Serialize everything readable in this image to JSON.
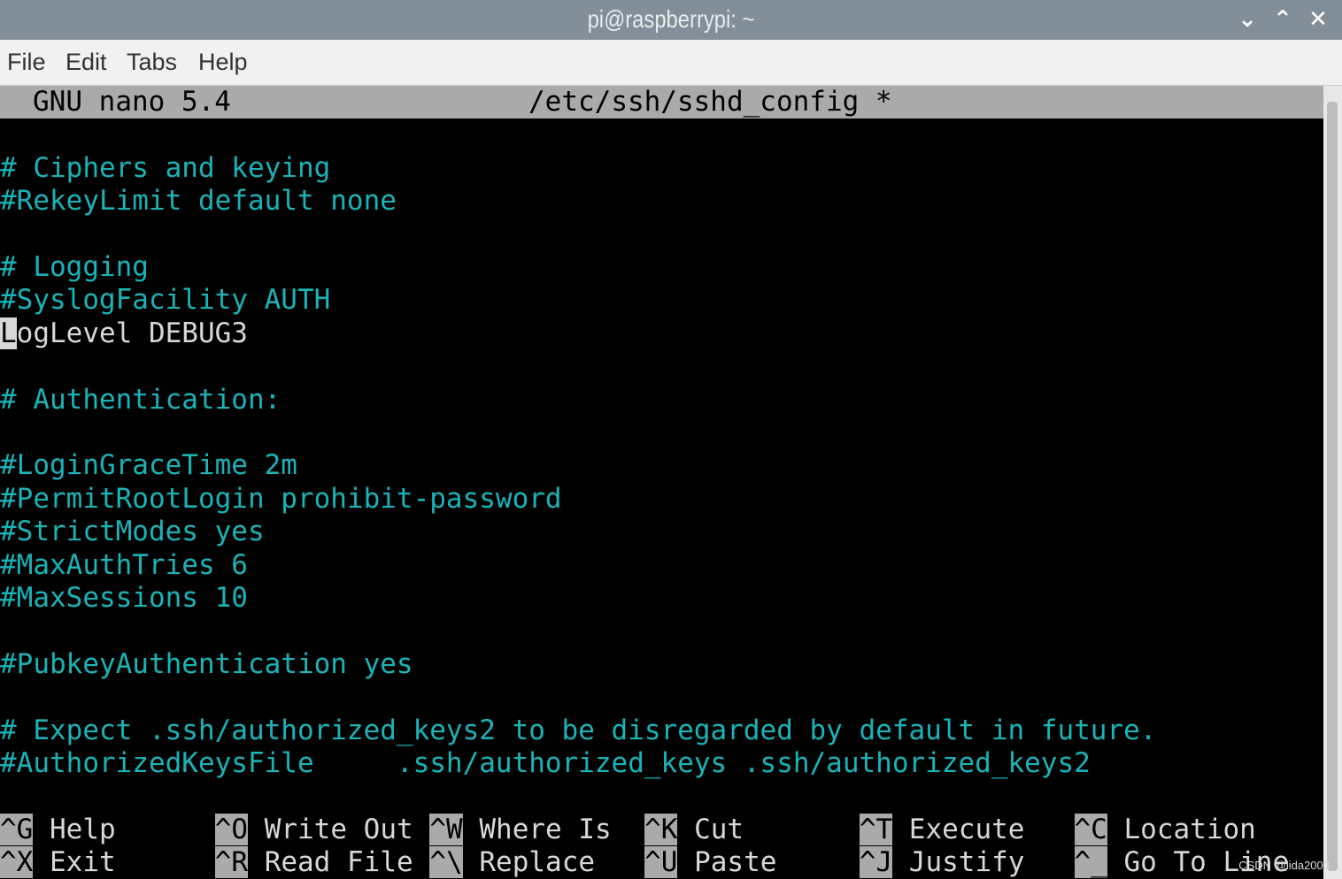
{
  "window": {
    "title": "pi@raspberrypi: ~",
    "buttons": [
      "minimize",
      "maximize",
      "close"
    ]
  },
  "menu": [
    "File",
    "Edit",
    "Tabs",
    "Help"
  ],
  "nano": {
    "version": "GNU nano 5.4",
    "filename": "/etc/ssh/sshd_config *"
  },
  "lines": [
    {
      "text": "",
      "style": "comment"
    },
    {
      "text": "# Ciphers and keying",
      "style": "comment"
    },
    {
      "text": "#RekeyLimit default none",
      "style": "comment"
    },
    {
      "text": "",
      "style": "comment"
    },
    {
      "text": "# Logging",
      "style": "comment"
    },
    {
      "text": "#SyslogFacility AUTH",
      "style": "comment"
    },
    {
      "text": "LogLevel DEBUG3",
      "style": "plain",
      "cursor": true
    },
    {
      "text": "",
      "style": "comment"
    },
    {
      "text": "# Authentication:",
      "style": "comment"
    },
    {
      "text": "",
      "style": "comment"
    },
    {
      "text": "#LoginGraceTime 2m",
      "style": "comment"
    },
    {
      "text": "#PermitRootLogin prohibit-password",
      "style": "comment"
    },
    {
      "text": "#StrictModes yes",
      "style": "comment"
    },
    {
      "text": "#MaxAuthTries 6",
      "style": "comment"
    },
    {
      "text": "#MaxSessions 10",
      "style": "comment"
    },
    {
      "text": "",
      "style": "comment"
    },
    {
      "text": "#PubkeyAuthentication yes",
      "style": "comment"
    },
    {
      "text": "",
      "style": "comment"
    },
    {
      "text": "# Expect .ssh/authorized_keys2 to be disregarded by default in future.",
      "style": "comment"
    },
    {
      "text": "#AuthorizedKeysFile     .ssh/authorized_keys .ssh/authorized_keys2",
      "style": "comment"
    }
  ],
  "shortcuts": [
    [
      {
        "key": "^G",
        "label": "Help"
      },
      {
        "key": "^O",
        "label": "Write Out"
      },
      {
        "key": "^W",
        "label": "Where Is"
      },
      {
        "key": "^K",
        "label": "Cut"
      },
      {
        "key": "^T",
        "label": "Execute"
      },
      {
        "key": "^C",
        "label": "Location"
      }
    ],
    [
      {
        "key": "^X",
        "label": "Exit"
      },
      {
        "key": "^R",
        "label": "Read File"
      },
      {
        "key": "^\\",
        "label": "Replace"
      },
      {
        "key": "^U",
        "label": "Paste"
      },
      {
        "key": "^J",
        "label": "Justify"
      },
      {
        "key": "^_",
        "label": "Go To Line"
      }
    ]
  ],
  "watermark": "CSDN @lida2003",
  "colors": {
    "comment": "#19b3b8",
    "plain": "#d8d8d8",
    "header_bg": "#aaaaaa",
    "titlebar": "#828f98"
  }
}
